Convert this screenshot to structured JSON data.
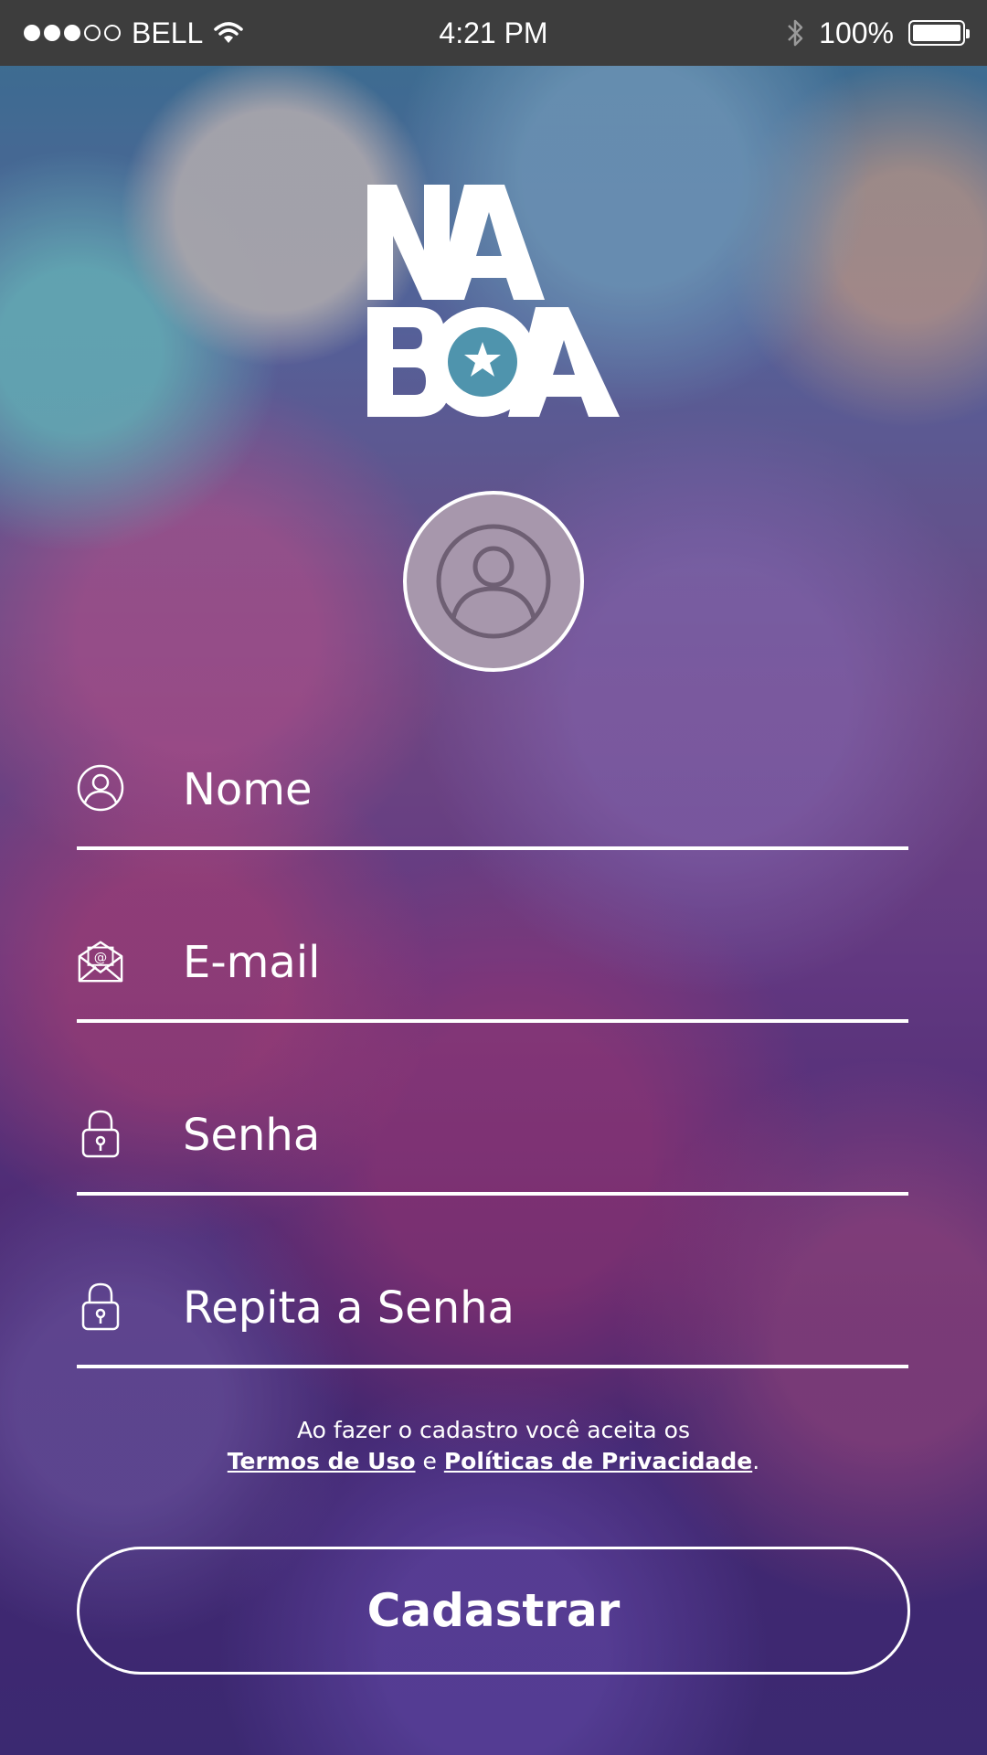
{
  "status_bar": {
    "carrier": "BELL",
    "time": "4:21 PM",
    "battery_percent": "100%",
    "signal_bars_filled": 3,
    "signal_bars_total": 5,
    "battery_level": 1.0
  },
  "logo": {
    "line1": "NA",
    "line2": "BOA"
  },
  "form": {
    "name_placeholder": "Nome",
    "email_placeholder": "E-mail",
    "password_placeholder": "Senha",
    "repeat_password_placeholder": "Repita a Senha"
  },
  "terms": {
    "intro": "Ao fazer o cadastro você aceita os",
    "terms_link": "Termos de Uso",
    "conjunction": "e",
    "privacy_link": "Políticas de Privacidade",
    "end": "."
  },
  "submit_label": "Cadastrar",
  "colors": {
    "status_bar": "#3d3d3d",
    "avatar_fill": "#a797ac",
    "logo_star_circle": "#4f94ad",
    "text": "#ffffff"
  },
  "icons": {
    "avatar": "user-circle-icon",
    "name": "user-circle-icon",
    "email": "envelope-at-icon",
    "password": "padlock-icon",
    "repeat_password": "padlock-icon"
  }
}
